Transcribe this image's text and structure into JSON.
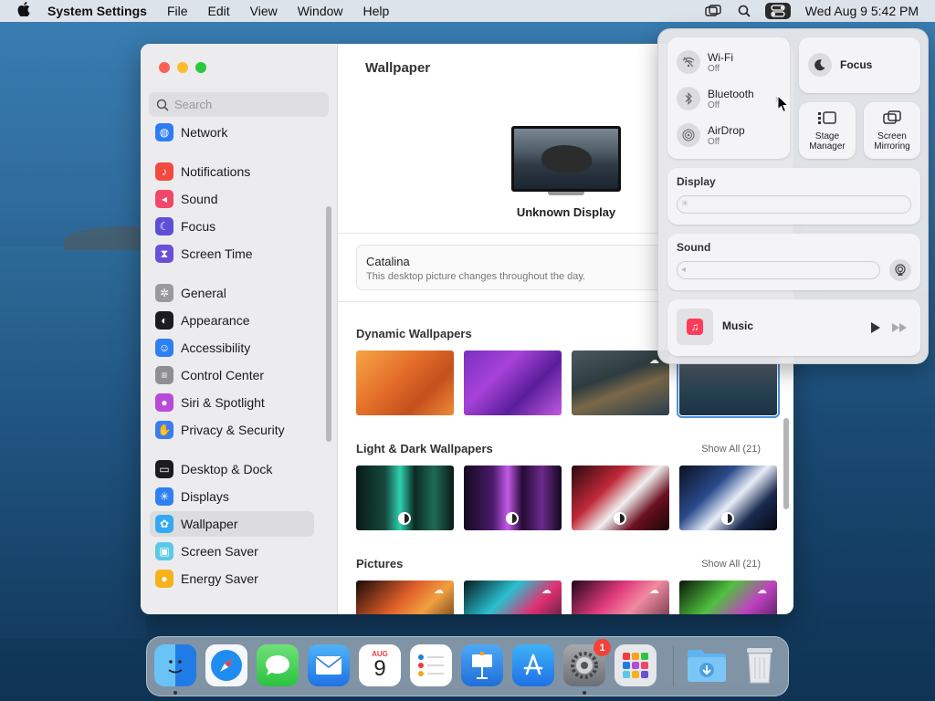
{
  "menubar": {
    "app_name": "System Settings",
    "menus": [
      "File",
      "Edit",
      "View",
      "Window",
      "Help"
    ],
    "clock": "Wed Aug 9  5:42 PM"
  },
  "sidebar": {
    "search_placeholder": "Search",
    "items": [
      {
        "label": "Network",
        "icon": "globe-icon",
        "color": "#2d7cf6"
      },
      {
        "label": "Notifications",
        "icon": "bell-icon",
        "color": "#f24a3f"
      },
      {
        "label": "Sound",
        "icon": "speaker-icon",
        "color": "#f2476a"
      },
      {
        "label": "Focus",
        "icon": "moon-icon",
        "color": "#5f4fd6"
      },
      {
        "label": "Screen Time",
        "icon": "hourglass-icon",
        "color": "#6a4fd8"
      },
      {
        "label": "General",
        "icon": "gear-icon",
        "color": "#9a9a9e"
      },
      {
        "label": "Appearance",
        "icon": "appearance-icon",
        "color": "#1c1c1e"
      },
      {
        "label": "Accessibility",
        "icon": "accessibility-icon",
        "color": "#2f80f0"
      },
      {
        "label": "Control Center",
        "icon": "toggles-icon",
        "color": "#8e8e93"
      },
      {
        "label": "Siri & Spotlight",
        "icon": "siri-icon",
        "color": "#b84bd8"
      },
      {
        "label": "Privacy & Security",
        "icon": "hand-icon",
        "color": "#3b7cf0"
      },
      {
        "label": "Desktop & Dock",
        "icon": "dock-icon",
        "color": "#1c1c1e"
      },
      {
        "label": "Displays",
        "icon": "sun-icon",
        "color": "#2f80f0"
      },
      {
        "label": "Wallpaper",
        "icon": "flower-icon",
        "color": "#33a9f2"
      },
      {
        "label": "Screen Saver",
        "icon": "screensaver-icon",
        "color": "#5ac8e8"
      },
      {
        "label": "Energy Saver",
        "icon": "bulb-icon",
        "color": "#f7b21b"
      }
    ],
    "selected": "Wallpaper"
  },
  "main": {
    "title": "Wallpaper",
    "display_name": "Unknown Display",
    "current": {
      "name": "Catalina",
      "description": "This desktop picture changes throughout the day."
    },
    "sections": [
      {
        "title": "Dynamic Wallpapers",
        "show_all": ""
      },
      {
        "title": "Light & Dark Wallpapers",
        "show_all": "Show All (21)"
      },
      {
        "title": "Pictures",
        "show_all": "Show All (21)"
      }
    ]
  },
  "control_center": {
    "wifi": {
      "label": "Wi-Fi",
      "status": "Off"
    },
    "bluetooth": {
      "label": "Bluetooth",
      "status": "Off"
    },
    "airdrop": {
      "label": "AirDrop",
      "status": "Off"
    },
    "focus": "Focus",
    "stage_manager": [
      "Stage",
      "Manager"
    ],
    "screen_mirroring": [
      "Screen",
      "Mirroring"
    ],
    "display_title": "Display",
    "sound_title": "Sound",
    "music_title": "Music"
  },
  "dock": {
    "items": [
      {
        "name": "Finder",
        "icon": "finder-icon",
        "running": true
      },
      {
        "name": "Safari",
        "icon": "safari-icon",
        "running": false
      },
      {
        "name": "Messages",
        "icon": "messages-icon",
        "running": false
      },
      {
        "name": "Mail",
        "icon": "mail-icon",
        "running": false
      },
      {
        "name": "Calendar",
        "icon": "calendar-icon",
        "running": false,
        "month": "AUG",
        "day": "9"
      },
      {
        "name": "Reminders",
        "icon": "reminders-icon",
        "running": false
      },
      {
        "name": "Keynote",
        "icon": "keynote-icon",
        "running": false
      },
      {
        "name": "App Store",
        "icon": "appstore-icon",
        "running": false
      },
      {
        "name": "System Settings",
        "icon": "settings-icon",
        "running": true,
        "badge": "1"
      },
      {
        "name": "Launchpad",
        "icon": "launchpad-icon",
        "running": false
      },
      {
        "name": "Downloads",
        "icon": "downloads-folder-icon",
        "running": false
      },
      {
        "name": "Trash",
        "icon": "trash-icon",
        "running": false
      }
    ]
  }
}
